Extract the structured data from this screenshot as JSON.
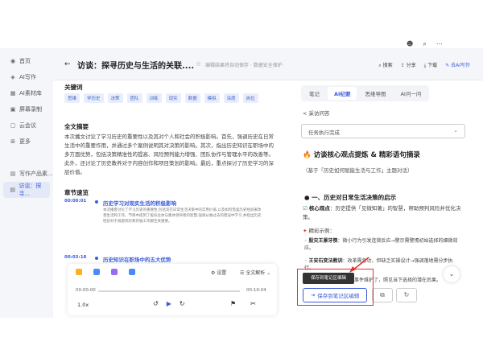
{
  "top_icons": [
    "☻",
    "⌕",
    "⋯"
  ],
  "sidebar": {
    "items": [
      {
        "label": "首页",
        "icon": "mic-icon"
      },
      {
        "label": "AI写作",
        "icon": "ai-icon"
      },
      {
        "label": "AI素材库",
        "icon": "library-icon"
      },
      {
        "label": "屏幕录制",
        "icon": "screen-record-icon"
      },
      {
        "label": "云会议",
        "icon": "meeting-icon"
      },
      {
        "label": "更多",
        "icon": "grid-icon"
      },
      {
        "label": "写作产品素...",
        "icon": "doc-icon"
      },
      {
        "label": "访谈：探寻...",
        "icon": "doc-icon"
      }
    ]
  },
  "header": {
    "title": "访谈：探寻历史与生活的关联....",
    "note": "编辑结果将自动保存 · 数据安全保护",
    "actions": [
      "搜索",
      "分享",
      "下载",
      "去AI写作"
    ]
  },
  "left": {
    "keywords_title": "关键词",
    "keywords": [
      "思维",
      "学历史",
      "决策",
      "团队",
      "训练",
      "现实",
      "数据",
      "模拟",
      "深度",
      "岗位"
    ],
    "summary_title": "全文摘要",
    "summary": "本次播文讨论了学习历史的重要性以及其对个人和社会的积极影响。首先，强调历史在日常生活中的重要作用，并通过多个案例说明其对决策的影响。其次，指出历史知识在职场中的多方面优势，包括决策精准性的提高、风险预判能力增强、团队协作与管理水平的改善等。此外，还讨论了历史教养对于内容创作和项目策划的影响。最后，重点探讨了历史学习的深层价值。",
    "chapters_title": "章节速览",
    "chapters": [
      {
        "time": "00:00:01",
        "title": "历史学习对现实生活的积极影响",
        "body": "本次播客讨论了学习历史的重要性,包括其在日常生活决策中的实用价值,以及如何借鉴历史经验来改善生活和工作。节目中提到了股份主体与集体领导者的智慧,强调从做过去的错误中学习,并指出历史经验对于规避风险和开展工作都至关重要。"
      },
      {
        "time": "00:03:18",
        "title": "历史知识在职场中的五大优势",
        "body": ""
      }
    ]
  },
  "player": {
    "settings": "设置",
    "expand": "全文解析",
    "time_start": "00:00:00",
    "time_end": "00:10:04",
    "speed": "1.0x",
    "progress": 0
  },
  "right": {
    "tabs": [
      "笔记",
      "AI纪要",
      "思维导图",
      "AI问一问"
    ],
    "active_tab": "AI纪要",
    "back_link": "采访问答",
    "select_value": "任务执行完成",
    "doc_title": "访谈核心观点提炼 & 精彩语句摘录",
    "doc_subtitle": "（基于「历史如何赋能生活与工作」主题对话）",
    "section1": "一、历史对日常生活决策的启示",
    "insight_label": "核心观点",
    "insight_text": "：历史提供「见微知著」的智慧，帮助预判风险并优化决策。",
    "example_label": "精彩示例：",
    "ex1_title": "股灾王景牙筷",
    "ex1_text": "：微小行为引发连锁反应→警示需警惕初始选择的细微效应。",
    "ex2_title": "王安石变法教训",
    "ex2_text": "：改革需急功，但缺乏实操设计→强调落地需分步执行。",
    "ex3_text": "郑人买履：不教条于事件维护了，照见当下选择的潜在后果。",
    "tooltip": "保存到笔记区编辑",
    "save_label": "保存到笔记区编辑"
  }
}
